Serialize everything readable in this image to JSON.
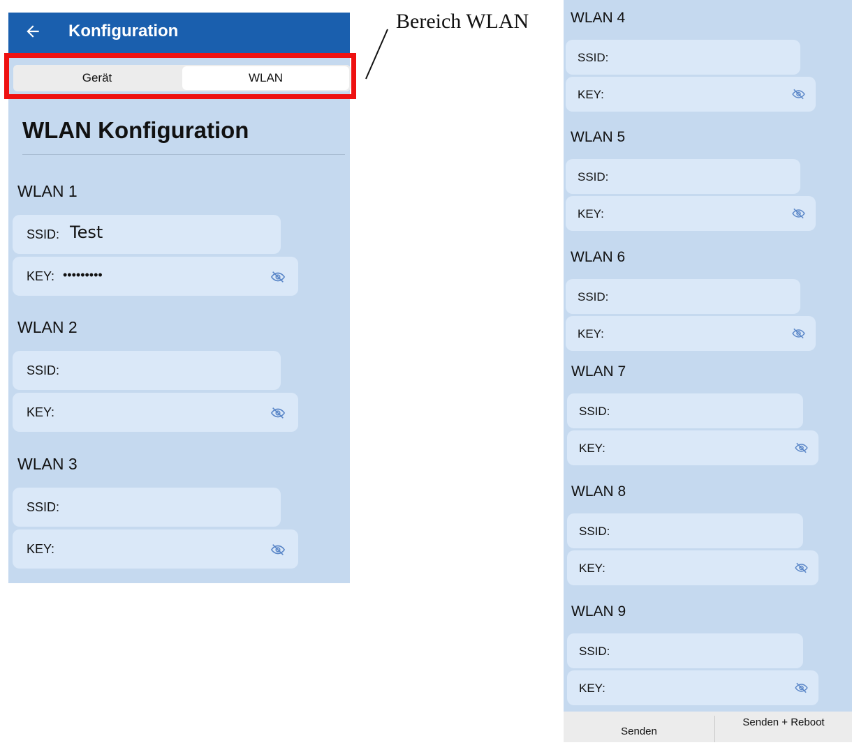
{
  "appbar": {
    "title": "Konfiguration"
  },
  "tabs": [
    {
      "label": "Gerät"
    },
    {
      "label": "WLAN"
    }
  ],
  "annotation": "Bereich WLAN",
  "section_title": "WLAN Konfiguration",
  "ssid_label": "SSID:",
  "key_label": "KEY:",
  "networks": [
    {
      "title": "WLAN 1",
      "ssid": "Test",
      "key": "•••••••••"
    },
    {
      "title": "WLAN 2",
      "ssid": "",
      "key": ""
    },
    {
      "title": "WLAN 3",
      "ssid": "",
      "key": ""
    },
    {
      "title": "WLAN 4",
      "ssid": "",
      "key": ""
    },
    {
      "title": "WLAN 5",
      "ssid": "",
      "key": ""
    },
    {
      "title": "WLAN 6",
      "ssid": "",
      "key": ""
    },
    {
      "title": "WLAN 7",
      "ssid": "",
      "key": ""
    },
    {
      "title": "WLAN 8",
      "ssid": "",
      "key": ""
    },
    {
      "title": "WLAN 9",
      "ssid": "",
      "key": ""
    }
  ],
  "buttons": {
    "send": "Senden",
    "send_reboot": "Senden + Reboot"
  },
  "colors": {
    "appbar": "#1a5fae",
    "panel": "#c5d9ef",
    "field": "#dae8f8",
    "highlight": "#ee1111"
  }
}
